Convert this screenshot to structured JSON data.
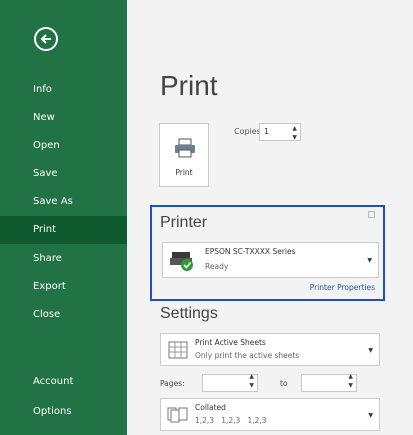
{
  "sidebar": {
    "items": [
      "Info",
      "New",
      "Open",
      "Save",
      "Save As",
      "Print",
      "Share",
      "Export",
      "Close",
      "Account",
      "Options"
    ],
    "active": "Print"
  },
  "main": {
    "title": "Print",
    "print_button_label": "Print",
    "copies_label": "Copies:",
    "copies_value": "1",
    "printer": {
      "section_title": "Printer",
      "name": "EPSON SC-TXXXX Series",
      "status": "Ready",
      "properties_link": "Printer Properties"
    },
    "settings": {
      "section_title": "Settings",
      "scope_main": "Print Active Sheets",
      "scope_sub": "Only print the active sheets",
      "pages_label": "Pages:",
      "to_label": "to",
      "collate_main": "Collated",
      "collate_sub": "1,2,3   1,2,3   1,2,3"
    }
  },
  "colors": {
    "sidebar": "#217346",
    "active": "#0f5a2e",
    "focus": "#1f4fcf",
    "link": "#1e5aa8"
  }
}
